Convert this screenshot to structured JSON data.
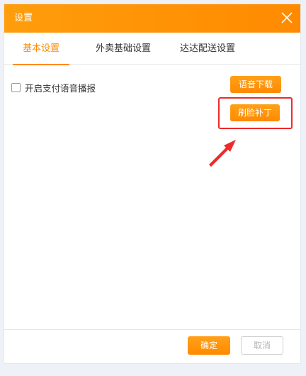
{
  "dialog": {
    "title": "设置",
    "close_icon": "close-icon"
  },
  "tabs": [
    {
      "label": "基本设置",
      "active": true
    },
    {
      "label": "外卖基础设置",
      "active": false
    },
    {
      "label": "达达配送设置",
      "active": false
    }
  ],
  "basic": {
    "voice_checkbox": {
      "label": "开启支付语音播报",
      "checked": false
    },
    "voice_download_button": "语音下载",
    "face_patch_button": "刷脸补丁"
  },
  "annotation": {
    "highlight_color": "#ee2a2a",
    "arrow_icon": "arrow-pointer-icon"
  },
  "footer": {
    "confirm_label": "确定",
    "cancel_label": "取消"
  },
  "colors": {
    "accent": "#ff8a00",
    "titlebar": "#ff9d0c"
  }
}
